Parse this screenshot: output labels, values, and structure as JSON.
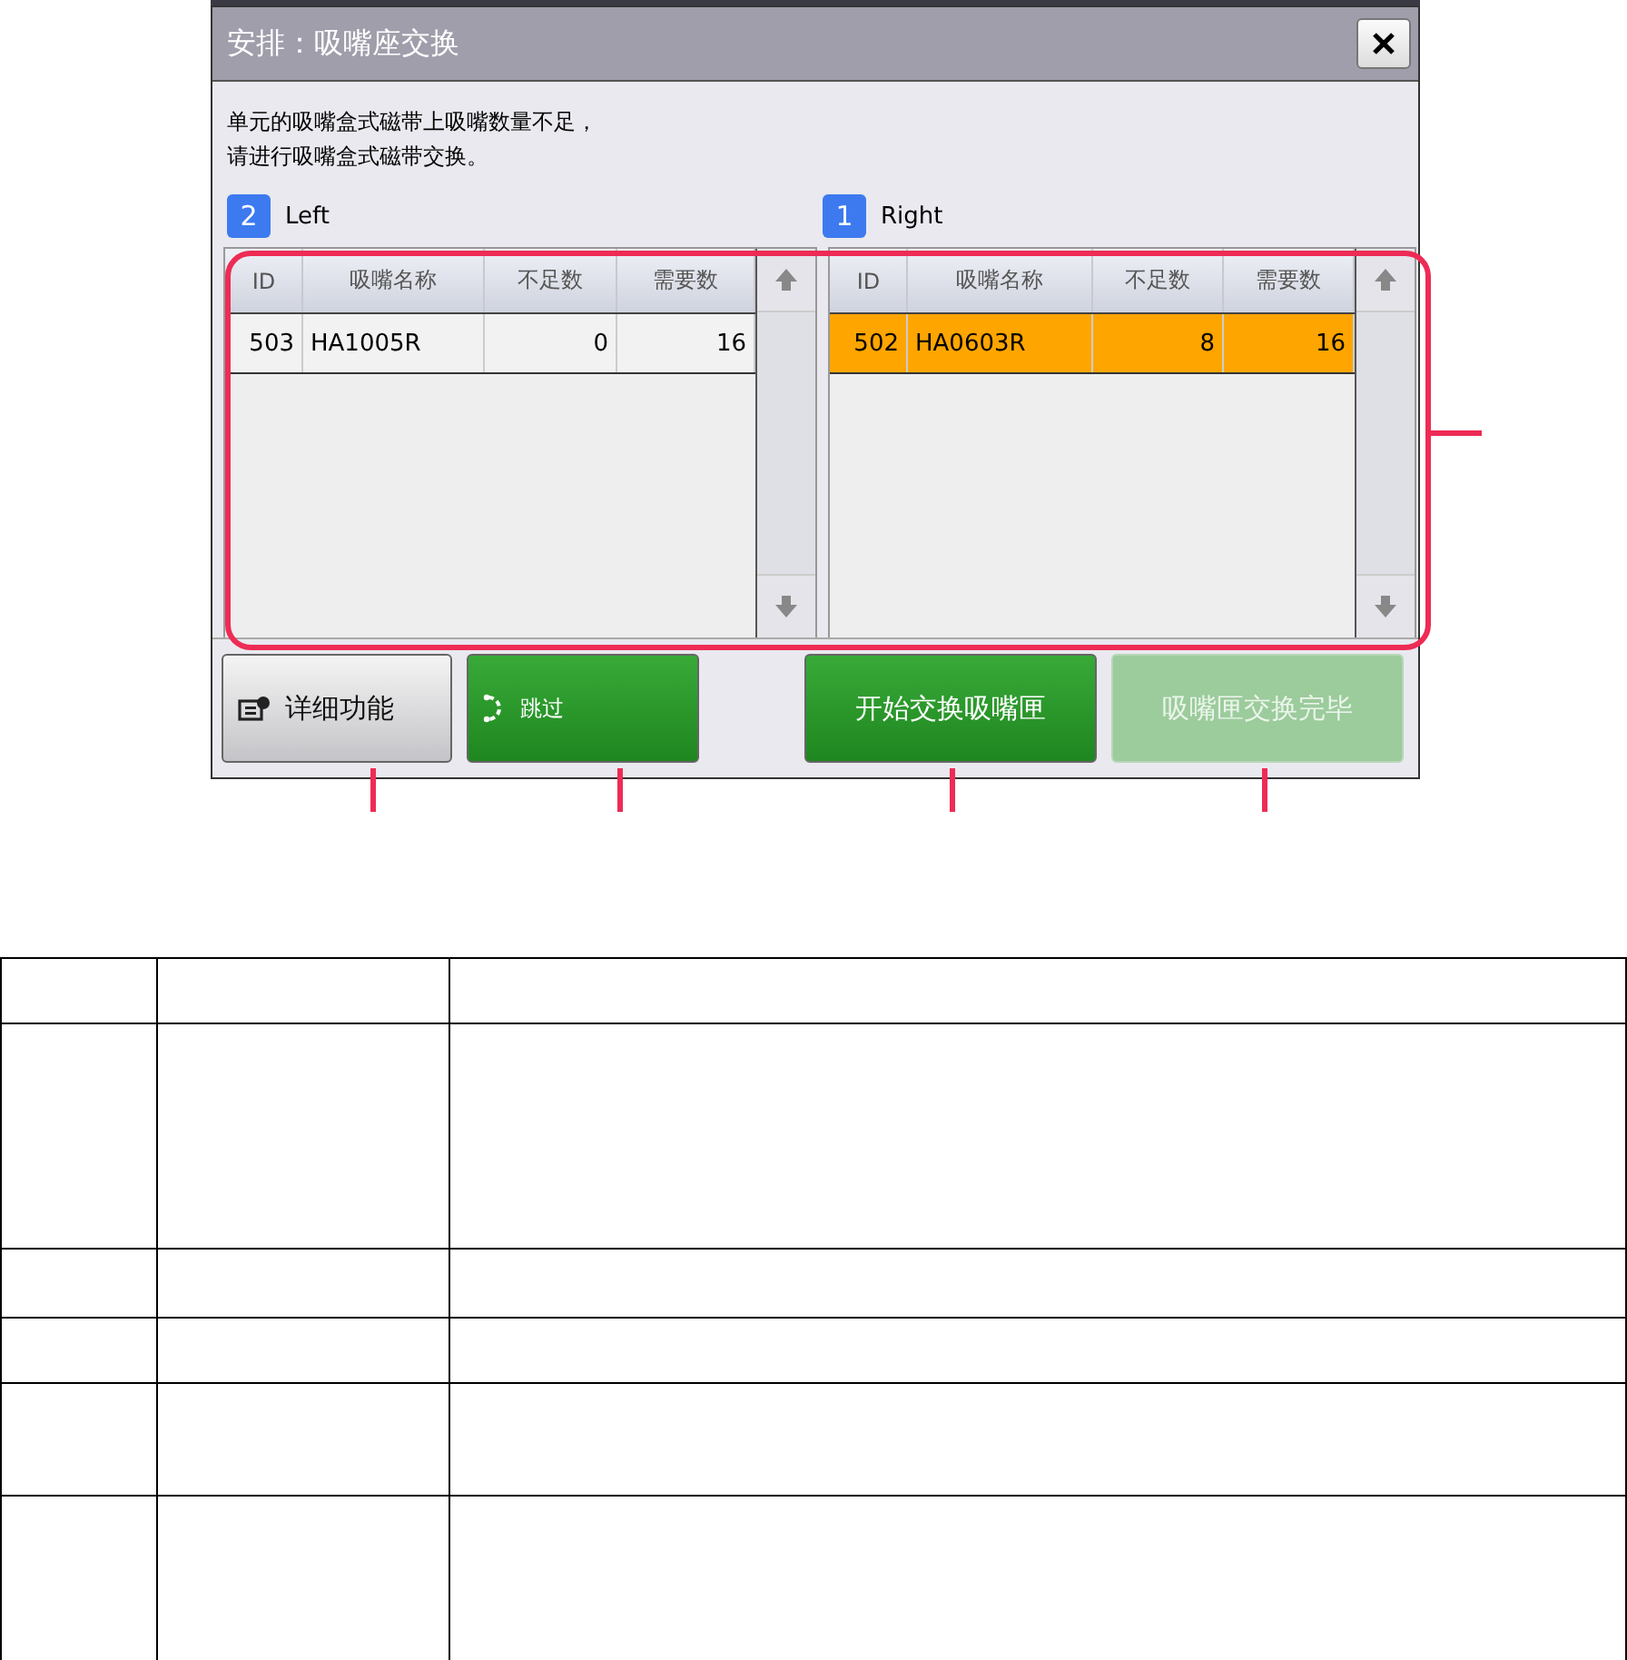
{
  "dialog": {
    "title": "安排：吸嘴座交换",
    "message": [
      "单元的吸嘴盒式磁带上吸嘴数量不足，",
      "请进行吸嘴盒式磁带交换。"
    ],
    "panels": [
      {
        "badge": "2",
        "label": "Left",
        "columns": [
          "ID",
          "吸嘴名称",
          "不足数",
          "需要数"
        ],
        "rows": [
          {
            "cells": [
              "503",
              "HA1005R",
              "0",
              "16"
            ],
            "selected": false
          }
        ]
      },
      {
        "badge": "1",
        "label": "Right",
        "columns": [
          "ID",
          "吸嘴名称",
          "不足数",
          "需要数"
        ],
        "rows": [
          {
            "cells": [
              "502",
              "HA0603R",
              "8",
              "16"
            ],
            "selected": true
          }
        ]
      }
    ],
    "buttons": [
      {
        "label": "详细功能",
        "kind": "detail",
        "disabled": false
      },
      {
        "label": "跳过",
        "kind": "skip",
        "disabled": false
      },
      {
        "label": "开始交换吸嘴匣",
        "kind": "action",
        "disabled": false
      },
      {
        "label": "吸嘴匣交换完毕",
        "kind": "action",
        "disabled": true
      }
    ]
  }
}
